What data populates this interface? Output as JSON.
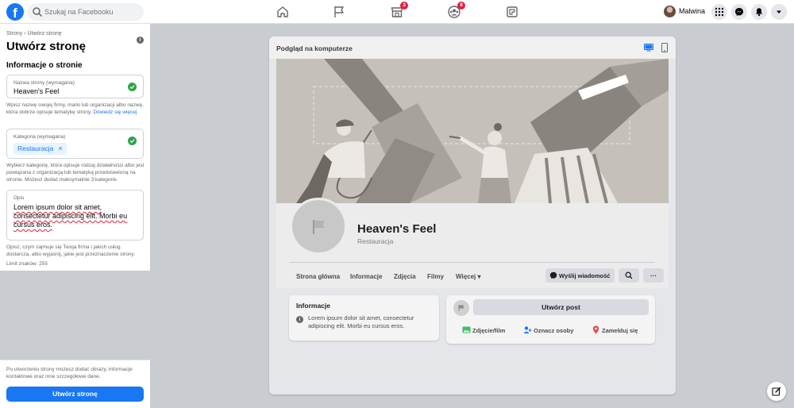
{
  "topbar": {
    "logo_letter": "f",
    "search_placeholder": "Szukaj na Facebooku",
    "nav": [
      {
        "icon": "home-icon"
      },
      {
        "icon": "flag-icon"
      },
      {
        "icon": "marketplace-icon",
        "badge": "3"
      },
      {
        "icon": "groups-icon",
        "badge": "8"
      },
      {
        "icon": "gaming-icon"
      }
    ],
    "profile_name": "Malwina"
  },
  "left_panel": {
    "breadcrumb": "Strony › Utwórz stronę",
    "title": "Utwórz stronę",
    "section_title": "Informacje o stronie",
    "name_field": {
      "label": "Nazwa strony (wymagana)",
      "value": "Heaven's Feel"
    },
    "name_helper": "Wpisz nazwę swojej firmy, marki lub organizacji albo nazwę, która dobrze opisuje tematykę strony.",
    "name_helper_link": "Dowiedz się więcej",
    "category_field": {
      "label": "Kategoria (wymagana)",
      "chip": "Restauracja",
      "chip_remove": "×"
    },
    "category_helper": "Wybierz kategorię, która opisuje rodzaj działalności albo jest powiązana z organizacją lub tematyką przedstawioną na stronie. Możesz dodać maksymalnie 3 kategorie.",
    "description_field": {
      "label": "Opis",
      "value": "Lorem ipsum dolor sit amet, consectetur adipiscing elit. Morbi eu cursus eros."
    },
    "description_helper": "Opisz, czym zajmuje się Twoja firma i jakich usług dostarcza, albo wyjaśnij, jakie jest przeznaczenie strony.",
    "char_limit": "Limit znaków: 255",
    "bottom_note": "Po utworzeniu strony możesz dodać obrazy, informacje kontaktowe oraz inne szczegółowe dane.",
    "create_button": "Utwórz stronę"
  },
  "preview": {
    "title": "Podgląd na komputerze",
    "page_name": "Heaven's Feel",
    "page_category": "Restauracja",
    "tabs": [
      "Strona główna",
      "Informacje",
      "Zdjęcia",
      "Filmy",
      "Więcej ▾"
    ],
    "message_button": "Wyślij wiadomość",
    "more_button": "···",
    "info_card": {
      "title": "Informacje",
      "text": "Lorem ipsum dolor sit amet, consectetur adipiscing elit. Morbi eu cursus eros."
    },
    "post_card": {
      "create_post": "Utwórz post",
      "actions": [
        "Zdjęcie/film",
        "Oznacz osoby",
        "Zamelduj się"
      ]
    }
  },
  "colors": {
    "brand": "#1877f2",
    "success": "#31a24c",
    "badge": "#e41e3f"
  }
}
